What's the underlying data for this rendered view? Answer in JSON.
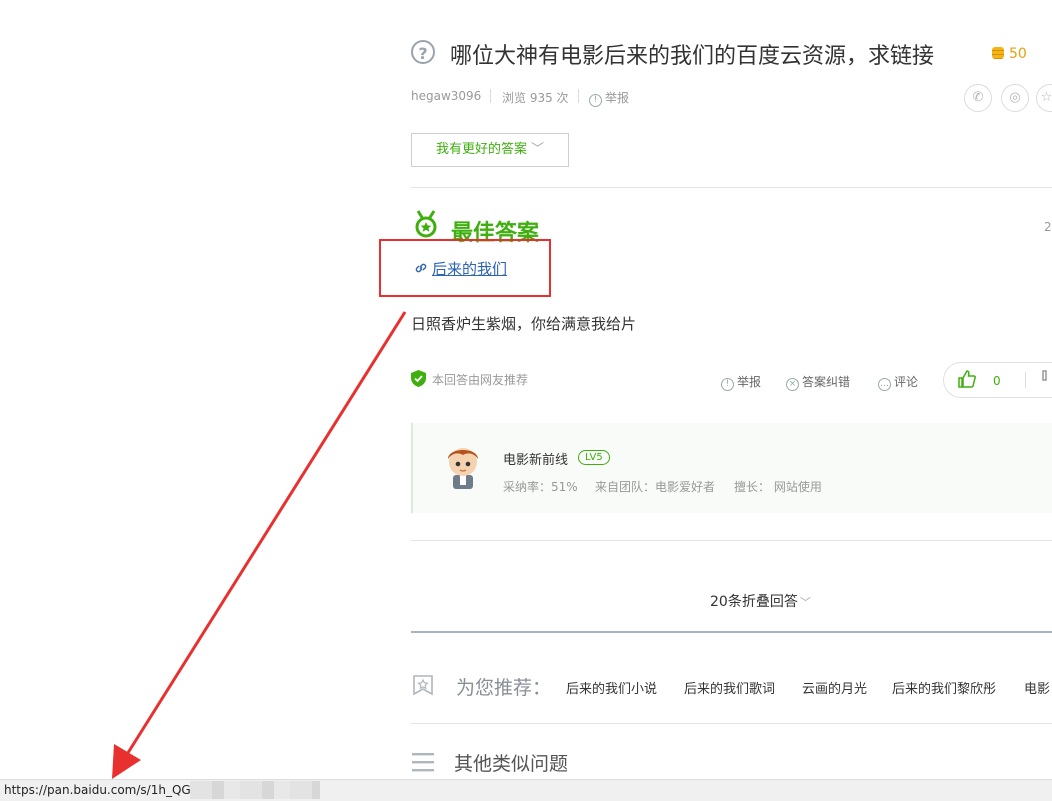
{
  "question": {
    "title": "哪位大神有电影后来的我们的百度云资源，求链接",
    "reward": "50",
    "user": "hegaw3096",
    "views": "浏览 935 次",
    "report": "举报",
    "better_answer_btn": "我有更好的答案",
    "share_icons": [
      "wechat-icon",
      "weibo-icon",
      "qzone-icon"
    ]
  },
  "best_answer": {
    "heading": "最佳答案",
    "date": "2",
    "link_text": "后来的我们",
    "text": "日照香炉生紫烟，你给满意我给片",
    "recommend": "本回答由网友推荐",
    "actions": {
      "report": "举报",
      "correct": "答案纠错",
      "comment": "评论"
    },
    "likes": "0"
  },
  "answerer": {
    "name": "电影新前线",
    "level": "LV5",
    "adopt_rate": "采纳率：51%",
    "team": "来自团队：电影爱好者",
    "expertise": "擅长： 网站使用"
  },
  "folded": "20条折叠回答",
  "recommend": {
    "title": "为您推荐：",
    "items": [
      "后来的我们小说",
      "后来的我们歌词",
      "云画的月光",
      "后来的我们黎欣彤",
      "电影"
    ]
  },
  "similar": {
    "title": "其他类似问题"
  },
  "status_bar": {
    "url": "https://pan.baidu.com/s/1h_QGN"
  },
  "colors": {
    "accent_green": "#3eaf0e",
    "link_blue": "#2d64b3",
    "annotation_red": "#e8312e",
    "reward_gold": "#e5a00d"
  }
}
